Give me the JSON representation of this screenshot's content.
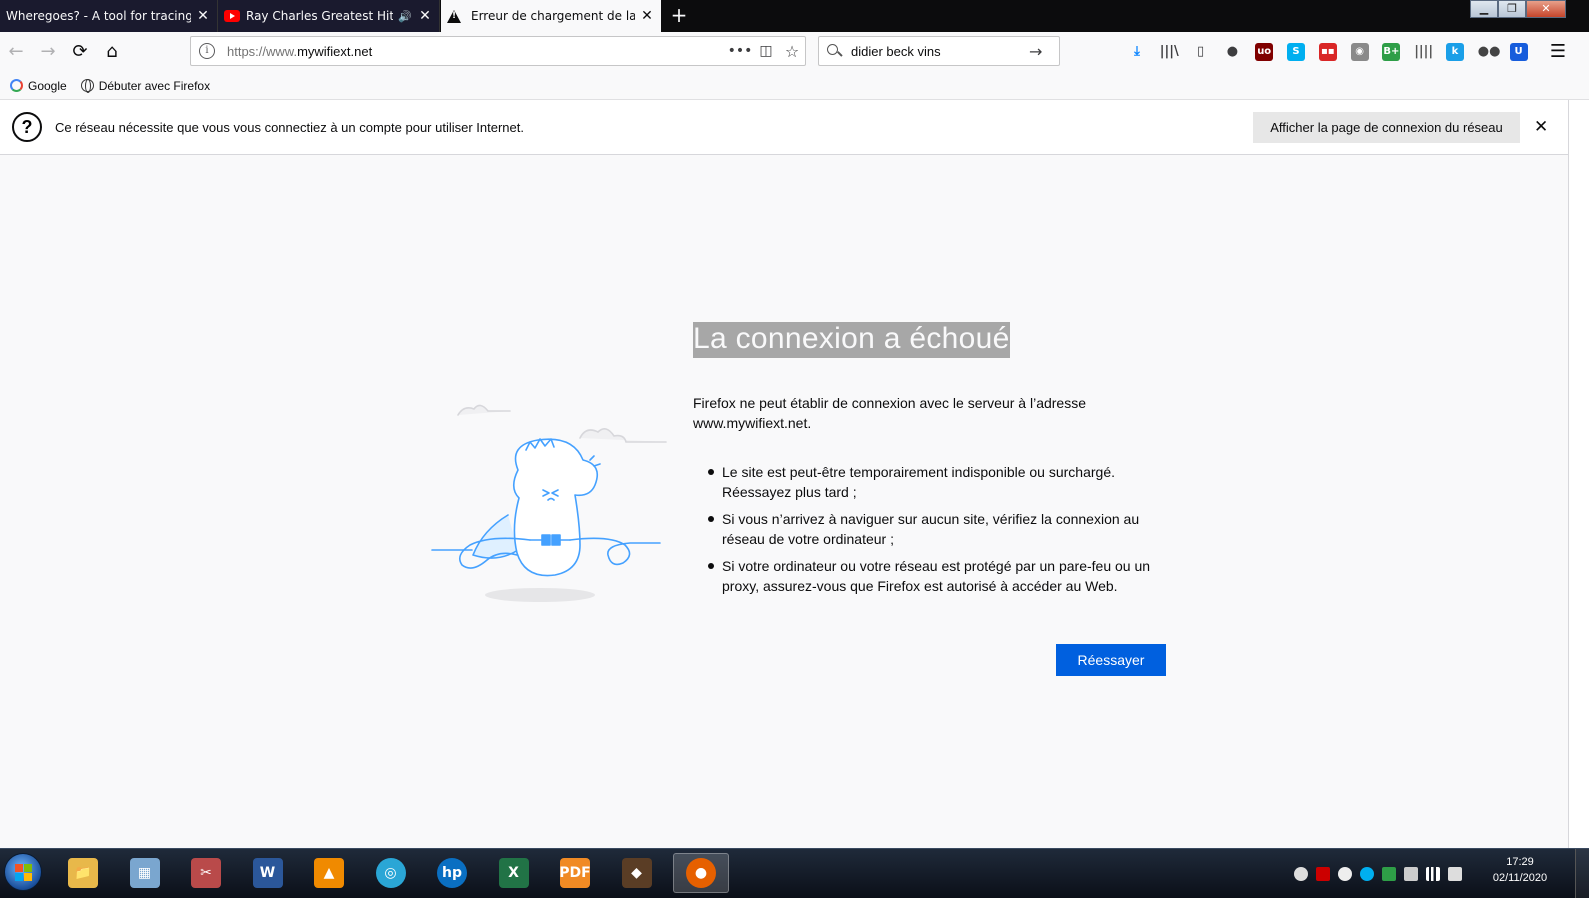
{
  "tabs": [
    {
      "title": "Wheregoes? - A tool for tracing the",
      "close": "✕"
    },
    {
      "title": "Ray Charles Greatest Hits - T",
      "audio": "🔊",
      "close": "✕"
    },
    {
      "title": "Erreur de chargement de la pag",
      "close": "✕"
    }
  ],
  "new_tab": "+",
  "window_controls": {
    "minimize": "▁",
    "restore": "❐",
    "close": "✕"
  },
  "nav": {
    "back": "←",
    "forward": "→",
    "reload": "⟳",
    "home": "⌂",
    "url_scheme": "https://www.",
    "url_host": "mywifiext.net",
    "page_actions": "•••",
    "pocket": "◫",
    "bookmark_star": "☆",
    "search_value": "didier beck vins",
    "search_go": "→",
    "menu": "☰"
  },
  "toolbar_icons": [
    {
      "name": "downloads-icon",
      "glyph": "⤓",
      "color": "#0a84ff"
    },
    {
      "name": "library-icon",
      "glyph": "|||\\",
      "color": "#3d3d3f"
    },
    {
      "name": "sidebar-icon",
      "glyph": "▯",
      "color": "#3d3d3f"
    },
    {
      "name": "account-icon",
      "glyph": "●",
      "color": "#3d3d3f"
    },
    {
      "name": "ublock-icon",
      "glyph": "uo",
      "color": "#800000"
    },
    {
      "name": "skype-icon",
      "glyph": "S",
      "color": "#00aff0"
    },
    {
      "name": "ext-red-icon",
      "glyph": "▪▪",
      "color": "#d92626"
    },
    {
      "name": "ext-grey-icon",
      "glyph": "◉",
      "color": "#8a8a8a"
    },
    {
      "name": "ext-green-icon",
      "glyph": "B+",
      "color": "#2e9e47"
    },
    {
      "name": "ext-bars-icon",
      "glyph": "||||",
      "color": "#555555"
    },
    {
      "name": "ext-k-icon",
      "glyph": "k",
      "color": "#1a9fe8"
    },
    {
      "name": "ext-people-icon",
      "glyph": "●●",
      "color": "#444444"
    },
    {
      "name": "bitwarden-icon",
      "glyph": "U",
      "color": "#175ddc"
    }
  ],
  "bookmarks": [
    {
      "label": "Google"
    },
    {
      "label": "Débuter avec Firefox"
    }
  ],
  "notification": {
    "icon": "?",
    "message": "Ce réseau nécessite que vous vous connectiez à un compte pour utiliser Internet.",
    "button": "Afficher la page de connexion du réseau",
    "close": "✕"
  },
  "error": {
    "title": "La connexion a échoué",
    "description": "Firefox ne peut établir de connexion avec le serveur à l’adresse www.mywifiext.net.",
    "bullets": [
      "Le site est peut-être temporairement indisponible ou surchargé. Réessayez plus tard ;",
      "Si vous n’arrivez à naviguer sur aucun site, vérifiez la connexion au réseau de votre ordinateur ;",
      "Si votre ordinateur ou votre réseau est protégé par un pare-feu ou un proxy, assurez-vous que Firefox est autorisé à accéder au Web."
    ],
    "retry": "Réessayer"
  },
  "taskbar": {
    "apps": [
      {
        "name": "explorer",
        "label": "📁",
        "color": "#e8b84a"
      },
      {
        "name": "calculator",
        "label": "▦",
        "color": "#7aa6cf"
      },
      {
        "name": "snipping",
        "label": "✂",
        "color": "#b94a4a"
      },
      {
        "name": "word",
        "label": "W",
        "color": "#2b579a"
      },
      {
        "name": "vlc",
        "label": "▲",
        "color": "#f08a00"
      },
      {
        "name": "communicator",
        "label": "◎",
        "color": "#2aa6d6"
      },
      {
        "name": "hp",
        "label": "hp",
        "color": "#0a6fc2"
      },
      {
        "name": "excel",
        "label": "X",
        "color": "#217346"
      },
      {
        "name": "pdf",
        "label": "PDF",
        "color": "#f08a24"
      },
      {
        "name": "game",
        "label": "◆",
        "color": "#5a3d25"
      },
      {
        "name": "firefox",
        "label": "●",
        "color": "#e66000"
      }
    ],
    "clock_time": "17:29",
    "clock_date": "02/11/2020"
  }
}
